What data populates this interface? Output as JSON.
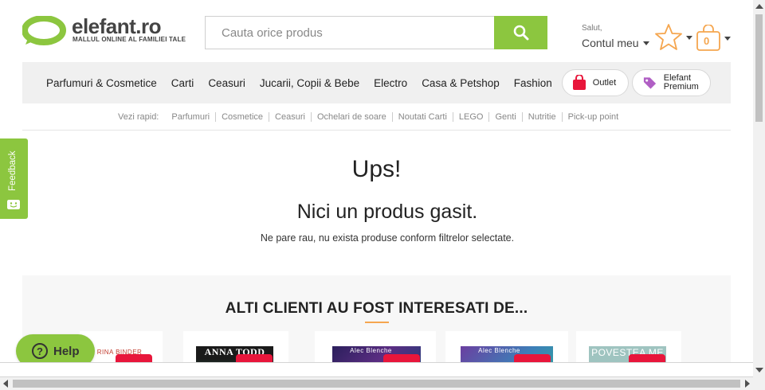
{
  "header": {
    "logo": {
      "name": "elefant.ro",
      "tagline": "MALLUL ONLINE AL FAMILIEI TALE"
    },
    "search": {
      "placeholder": "Cauta orice produs"
    },
    "account": {
      "greeting": "Salut,",
      "link": "Contul meu"
    },
    "cart": {
      "count": "0"
    }
  },
  "nav": {
    "items": [
      "Parfumuri & Cosmetice",
      "Carti",
      "Ceasuri",
      "Jucarii, Copii & Bebe",
      "Electro",
      "Casa & Petshop",
      "Fashion"
    ],
    "outlet": "Outlet",
    "premium_line1": "Elefant",
    "premium_line2": "Premium"
  },
  "quick_links": {
    "title": "Vezi rapid:",
    "items": [
      "Parfumuri",
      "Cosmetice",
      "Ceasuri",
      "Ochelari de soare",
      "Noutati Carti",
      "LEGO",
      "Genti",
      "Nutritie",
      "Pick-up point"
    ]
  },
  "empty_state": {
    "heading": "Ups!",
    "subheading": "Nici un produs gasit.",
    "message": "Ne pare rau, nu exista produse conform filtrelor selectate."
  },
  "recommendations": {
    "title": "ALTI CLIENTI AU FOST INTERESATI DE...",
    "cover_texts": [
      "RINA BINDER",
      "ANNA TODD",
      "Alec Blenche",
      "Alec Blenche",
      "POVESTEA ME"
    ]
  },
  "feedback": {
    "label": "Feedback"
  },
  "help": {
    "label": "Help"
  },
  "colors": {
    "brand_green": "#8cc63f",
    "accent_orange": "#f5a64f",
    "sale_red": "#e8163b"
  }
}
